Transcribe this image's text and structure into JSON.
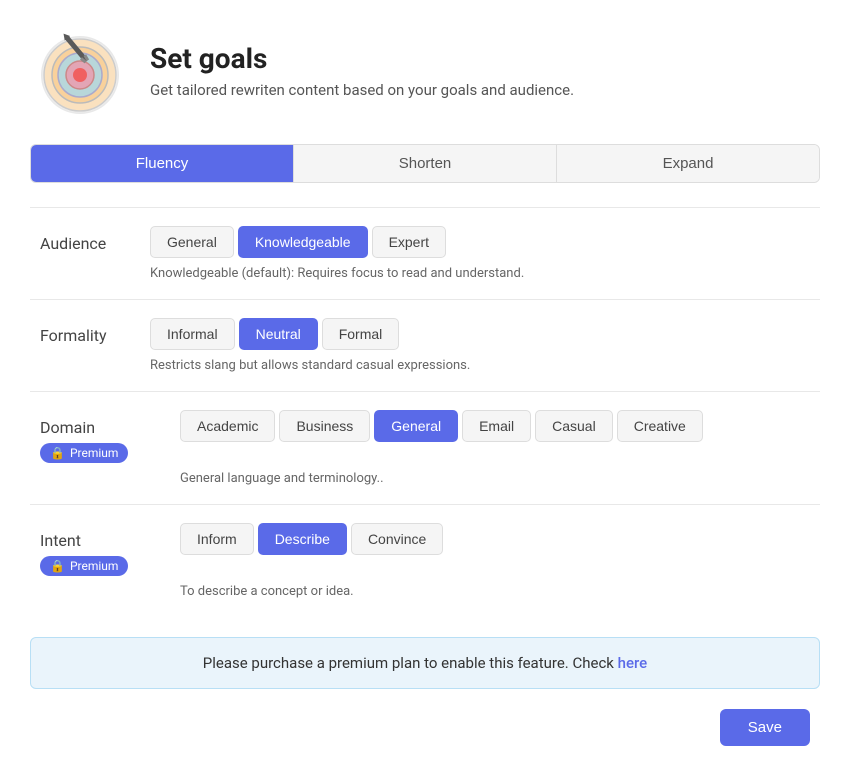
{
  "header": {
    "title": "Set goals",
    "subtitle": "Get tailored rewriten content based on your goals and audience."
  },
  "tabs": [
    {
      "label": "Fluency",
      "active": true
    },
    {
      "label": "Shorten",
      "active": false
    },
    {
      "label": "Expand",
      "active": false
    }
  ],
  "audience": {
    "label": "Audience",
    "options": [
      "General",
      "Knowledgeable",
      "Expert"
    ],
    "active": "Knowledgeable",
    "description": "Knowledgeable (default): Requires focus to read and understand."
  },
  "formality": {
    "label": "Formality",
    "options": [
      "Informal",
      "Neutral",
      "Formal"
    ],
    "active": "Neutral",
    "description": "Restricts slang but allows standard casual expressions."
  },
  "domain": {
    "label": "Domain",
    "premium_label": "Premium",
    "options": [
      "Academic",
      "Business",
      "General",
      "Email",
      "Casual",
      "Creative"
    ],
    "active": "General",
    "description": "General language and terminology.."
  },
  "intent": {
    "label": "Intent",
    "premium_label": "Premium",
    "options": [
      "Inform",
      "Describe",
      "Convince"
    ],
    "active": "Describe",
    "description": "To describe a concept or idea."
  },
  "premium_notice": {
    "text": "Please purchase a premium plan to enable this feature. Check",
    "link_label": "here"
  },
  "save_button": "Save",
  "lock_icon": "🔒"
}
